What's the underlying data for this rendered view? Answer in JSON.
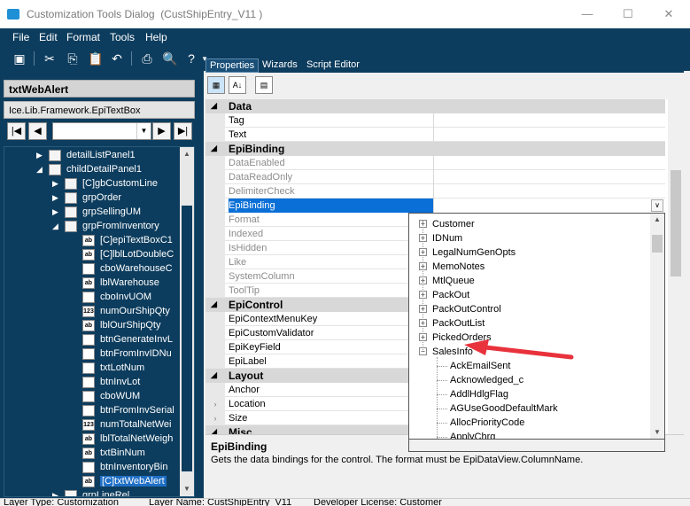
{
  "window": {
    "title": "Customization Tools Dialog",
    "subtitle": "(CustShipEntry_V11 )",
    "minimize": "—",
    "maximize": "☐",
    "close": "✕"
  },
  "menu": [
    "File",
    "Edit",
    "Format",
    "Tools",
    "Help"
  ],
  "toolbar": [
    "save-icon",
    "cut-icon",
    "copy-icon",
    "paste-icon",
    "undo-icon",
    "print-icon",
    "print-preview-icon",
    "help-icon"
  ],
  "left": {
    "control_name": "txtWebAlert",
    "control_type": "Ice.Lib.Framework.EpiTextBox",
    "nav": {
      "first": "|◀",
      "prev": "◀",
      "next": "▶",
      "last": "▶|",
      "combo_value": ""
    },
    "tree": [
      {
        "label": "detailListPanel1",
        "icon": "",
        "expander": "▶"
      },
      {
        "label": "childDetailPanel1",
        "icon": "",
        "expander": "◢"
      },
      {
        "label": "[C]gbCustomLine",
        "icon": "",
        "expander": "▶"
      },
      {
        "label": "grpOrder",
        "icon": "",
        "expander": "▶"
      },
      {
        "label": "grpSellingUM",
        "icon": "",
        "expander": "▶"
      },
      {
        "label": "grpFromInventory",
        "icon": "",
        "expander": "◢"
      },
      {
        "label": "[C]epiTextBoxC1",
        "icon": "ab",
        "expander": ""
      },
      {
        "label": "[C]lblLotDoubleC",
        "icon": "ab",
        "expander": ""
      },
      {
        "label": "cboWarehouseC",
        "icon": "",
        "expander": ""
      },
      {
        "label": "lblWarehouse",
        "icon": "ab",
        "expander": ""
      },
      {
        "label": "cboInvUOM",
        "icon": "",
        "expander": ""
      },
      {
        "label": "numOurShipQty",
        "icon": "123",
        "expander": ""
      },
      {
        "label": "lblOurShipQty",
        "icon": "ab",
        "expander": ""
      },
      {
        "label": "btnGenerateInvL",
        "icon": "",
        "expander": ""
      },
      {
        "label": "btnFromInvIDNu",
        "icon": "",
        "expander": ""
      },
      {
        "label": "txtLotNum",
        "icon": "",
        "expander": ""
      },
      {
        "label": "btnInvLot",
        "icon": "",
        "expander": ""
      },
      {
        "label": "cboWUM",
        "icon": "",
        "expander": ""
      },
      {
        "label": "btnFromInvSerial",
        "icon": "",
        "expander": ""
      },
      {
        "label": "numTotalNetWei",
        "icon": "123",
        "expander": ""
      },
      {
        "label": "lblTotalNetWeigh",
        "icon": "ab",
        "expander": ""
      },
      {
        "label": "txtBinNum",
        "icon": "ab",
        "expander": ""
      },
      {
        "label": "btnInventoryBin",
        "icon": "",
        "expander": ""
      },
      {
        "label": "[C]txtWebAlert",
        "icon": "ab",
        "expander": "",
        "selected": true
      },
      {
        "label": "grpLineRel",
        "icon": "",
        "expander": "▶"
      }
    ]
  },
  "tabs": [
    "Properties",
    "Wizards",
    "Script Editor"
  ],
  "grid": {
    "rows": [
      {
        "type": "cat",
        "label": "Data",
        "expander": "◢"
      },
      {
        "type": "prop",
        "label": "Tag",
        "disabled": false
      },
      {
        "type": "prop",
        "label": "Text",
        "disabled": false
      },
      {
        "type": "cat",
        "label": "EpiBinding",
        "expander": "◢"
      },
      {
        "type": "prop",
        "label": "DataEnabled",
        "disabled": true
      },
      {
        "type": "prop",
        "label": "DataReadOnly",
        "disabled": true
      },
      {
        "type": "prop",
        "label": "DelimiterCheck",
        "disabled": true
      },
      {
        "type": "prop",
        "label": "EpiBinding",
        "disabled": false,
        "selected": true
      },
      {
        "type": "prop",
        "label": "Format",
        "disabled": true
      },
      {
        "type": "prop",
        "label": "Indexed",
        "disabled": true
      },
      {
        "type": "prop",
        "label": "IsHidden",
        "disabled": true
      },
      {
        "type": "prop",
        "label": "Like",
        "disabled": true
      },
      {
        "type": "prop",
        "label": "SystemColumn",
        "disabled": true
      },
      {
        "type": "prop",
        "label": "ToolTip",
        "disabled": true
      },
      {
        "type": "cat",
        "label": "EpiControl",
        "expander": "◢"
      },
      {
        "type": "prop",
        "label": "EpiContextMenuKey",
        "disabled": false
      },
      {
        "type": "prop",
        "label": "EpiCustomValidator",
        "disabled": false
      },
      {
        "type": "prop",
        "label": "EpiKeyField",
        "disabled": false
      },
      {
        "type": "prop",
        "label": "EpiLabel",
        "disabled": false
      },
      {
        "type": "cat",
        "label": "Layout",
        "expander": "◢"
      },
      {
        "type": "prop",
        "label": "Anchor",
        "disabled": false
      },
      {
        "type": "prop",
        "label": "Location",
        "disabled": false,
        "gutter": "›"
      },
      {
        "type": "prop",
        "label": "Size",
        "disabled": false,
        "gutter": "›"
      },
      {
        "type": "cat",
        "label": "Misc",
        "expander": "◢"
      }
    ]
  },
  "description": {
    "title": "EpiBinding",
    "text": "Gets the data bindings for the control. The format must be EpiDataView.ColumnName."
  },
  "popup": {
    "items": [
      {
        "label": "Customer",
        "level": 0,
        "box": "+"
      },
      {
        "label": "IDNum",
        "level": 0,
        "box": "+"
      },
      {
        "label": "LegalNumGenOpts",
        "level": 0,
        "box": "+"
      },
      {
        "label": "MemoNotes",
        "level": 0,
        "box": "+"
      },
      {
        "label": "MtlQueue",
        "level": 0,
        "box": "+"
      },
      {
        "label": "PackOut",
        "level": 0,
        "box": "+"
      },
      {
        "label": "PackOutControl",
        "level": 0,
        "box": "+"
      },
      {
        "label": "PackOutList",
        "level": 0,
        "box": "+"
      },
      {
        "label": "PickedOrders",
        "level": 0,
        "box": "+"
      },
      {
        "label": "SalesInfo",
        "level": 0,
        "box": "−"
      },
      {
        "label": "AckEmailSent",
        "level": 1
      },
      {
        "label": "Acknowledged_c",
        "level": 1
      },
      {
        "label": "AddlHdlgFlag",
        "level": 1
      },
      {
        "label": "AGUseGoodDefaultMark",
        "level": 1
      },
      {
        "label": "AllocPriorityCode",
        "level": 1
      },
      {
        "label": "ApplyChrg",
        "level": 1
      }
    ]
  },
  "status": {
    "layer_type": "Layer Type:  Customization",
    "layer_name": "Layer Name:  CustShipEntry_V11",
    "developer_license": "Developer License:  Customer"
  },
  "colors": {
    "accent": "#0d3d5e",
    "selection": "#0a6fd6",
    "arrow": "#e8323c"
  }
}
